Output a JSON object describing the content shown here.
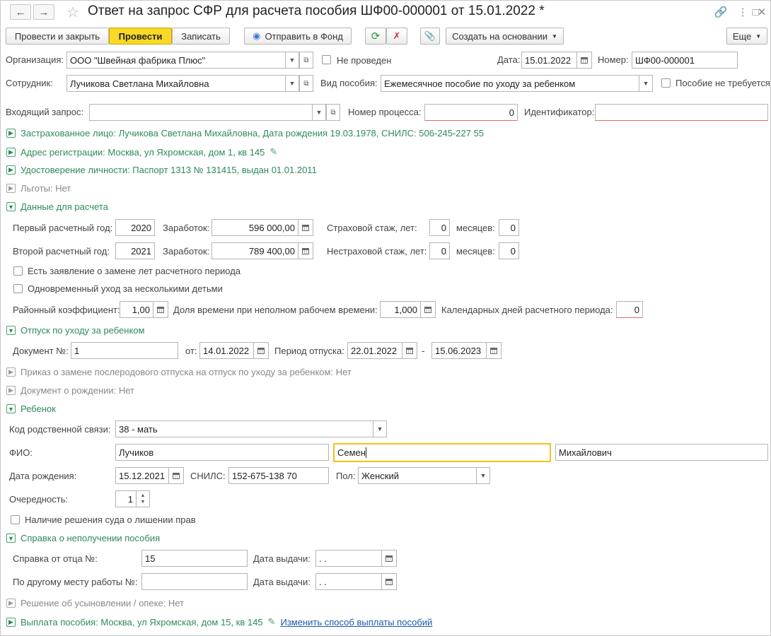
{
  "window": {
    "title": "Ответ на запрос СФР для расчета пособия ШФ00-000001 от 15.01.2022 *"
  },
  "toolbar": {
    "post_close": "Провести и закрыть",
    "post": "Провести",
    "save": "Записать",
    "send_fund": "Отправить в Фонд",
    "create_based": "Создать на основании",
    "more": "Еще"
  },
  "header": {
    "org_label": "Организация:",
    "org_value": "ООО \"Швейная фабрика Плюс\"",
    "not_posted": "Не проведен",
    "date_label": "Дата:",
    "date_value": "15.01.2022",
    "number_label": "Номер:",
    "number_value": "ШФ00-000001",
    "employee_label": "Сотрудник:",
    "employee_value": "Лучикова Светлана Михайловна",
    "benefit_type_label": "Вид пособия:",
    "benefit_type_value": "Ежемесячное пособие по уходу за ребенком",
    "not_required": "Пособие не требуется",
    "incoming_label": "Входящий запрос:",
    "incoming_value": "",
    "process_label": "Номер процесса:",
    "process_value": "0",
    "identifier_label": "Идентификатор:",
    "identifier_value": ""
  },
  "sections": {
    "insured": "Застрахованное лицо: Лучикова Светлана Михайловна, Дата рождения 19.03.1978, СНИЛС: 506-245-227 55",
    "address": "Адрес регистрации: Москва, ул Яхромская, дом 1, кв 145",
    "identity": "Удостоверение личности: Паспорт 1313 № 131415, выдан 01.01.2011",
    "benefits": "Льготы: Нет",
    "calc": "Данные для расчета",
    "leave": "Отпуск по уходу за ребенком",
    "order": "Приказ о замене послеродового отпуска на отпуск по уходу за ребенком: Нет",
    "birth_doc": "Документ о рождении: Нет",
    "child": "Ребенок",
    "certificate": "Справка о неполучении пособия",
    "adoption": "Решение об усыновлении / опеке: Нет",
    "payment": "Выплата пособия: Москва, ул Яхромская, дом 15, кв 145",
    "payment_link": "Изменить способ выплаты пособий"
  },
  "calc": {
    "year1_label": "Первый расчетный год:",
    "year1": "2020",
    "earn1_label": "Заработок:",
    "earn1": "596 000,00",
    "ins_years_label": "Страховой стаж, лет:",
    "ins_years": "0",
    "months_label": "месяцев:",
    "ins_months": "0",
    "year2_label": "Второй расчетный год:",
    "year2": "2021",
    "earn2_label": "Заработок:",
    "earn2": "789 400,00",
    "nonins_years_label": "Нестраховой стаж, лет:",
    "nonins_years": "0",
    "months2_label": "месяцев:",
    "nonins_months": "0",
    "replace_years": "Есть заявление о замене лет расчетного периода",
    "several_children": "Одновременный уход за несколькими детьми",
    "regional_label": "Районный коэффициент:",
    "regional": "1,00",
    "parttime_label": "Доля времени при неполном рабочем времени:",
    "parttime": "1,000",
    "calendar_days_label": "Календарных дней расчетного периода:",
    "calendar_days": "0"
  },
  "leave": {
    "doc_label": "Документ №:",
    "doc": "1",
    "from_label": "от:",
    "from": "14.01.2022",
    "period_label": "Период отпуска:",
    "period_start": "22.01.2022",
    "dash": "-",
    "period_end": "15.06.2023"
  },
  "child": {
    "relation_label": "Код родственной связи:",
    "relation": "38 - мать",
    "fio_label": "ФИО:",
    "last_name": "Лучиков",
    "first_name": "Семен",
    "middle_name": "Михайлович",
    "birth_label": "Дата рождения:",
    "birth": "15.12.2021",
    "snils_label": "СНИЛС:",
    "snils": "152-675-138 70",
    "sex_label": "Пол:",
    "sex": "Женский",
    "order_label": "Очередность:",
    "order": "1",
    "court": "Наличие решения суда о лишении прав"
  },
  "certificate": {
    "father_label": "Справка от отца №:",
    "father": "15",
    "issue_label": "Дата выдачи:",
    "issue1": " .  .",
    "other_label": "По другому месту работы №:",
    "other": "",
    "issue2_label": "Дата выдачи:",
    "issue2": " .  ."
  }
}
